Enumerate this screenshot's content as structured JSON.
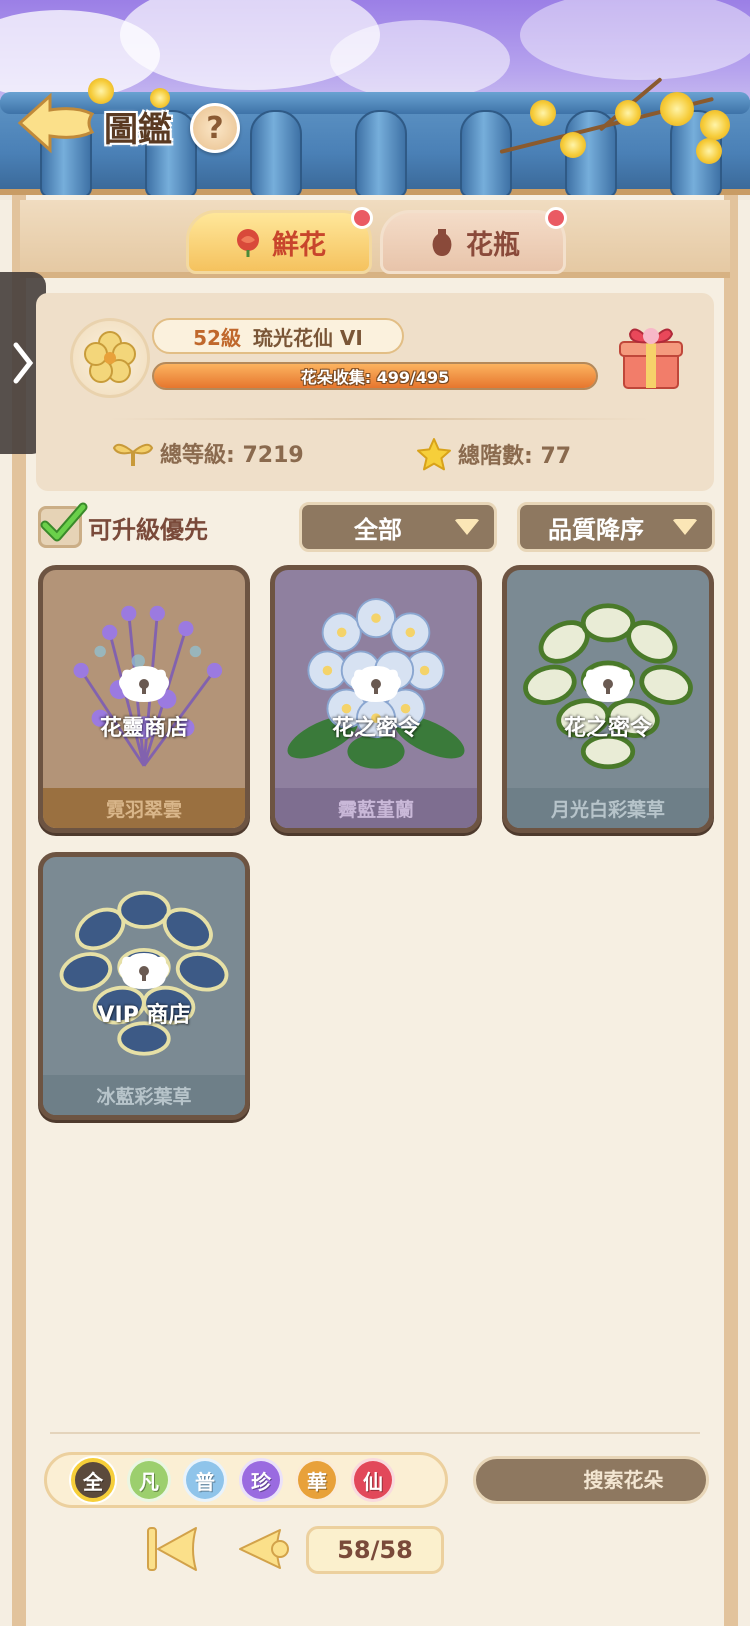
{
  "header": {
    "title": "圖鑑",
    "help_label": "?"
  },
  "tabs": [
    {
      "label": "鮮花",
      "active": true,
      "has_dot": true
    },
    {
      "label": "花瓶",
      "active": false,
      "has_dot": true
    }
  ],
  "player": {
    "level": "52級",
    "rank": "琉光花仙 VI",
    "collection_text": "花朵收集: 499/495",
    "collection_progress": 1.0,
    "total_level_label": "總等級: 7219",
    "total_stage_label": "總階數: 77"
  },
  "filters": {
    "upgrade_priority_label": "可升級優先",
    "upgrade_priority_checked": true,
    "category_label": "全部",
    "sort_label": "品質降序"
  },
  "flowers": [
    {
      "name": "霓羽翠雲",
      "source": "花靈商店",
      "theme": "brown"
    },
    {
      "name": "霽藍堇蘭",
      "source": "花之密令",
      "theme": "purple"
    },
    {
      "name": "月光白彩葉草",
      "source": "花之密令",
      "theme": "slate"
    },
    {
      "name": "冰藍彩葉草",
      "source": "VIP 商店",
      "theme": "slate"
    }
  ],
  "rarity_filters": [
    {
      "label": "全",
      "color": "#5b4a3c",
      "selected": true
    },
    {
      "label": "凡",
      "color": "#9ccf6e",
      "selected": false
    },
    {
      "label": "普",
      "color": "#8fc4ea",
      "selected": false
    },
    {
      "label": "珍",
      "color": "#9a6be0",
      "selected": false
    },
    {
      "label": "華",
      "color": "#e8a13a",
      "selected": false
    },
    {
      "label": "仙",
      "color": "#e2485a",
      "selected": false
    }
  ],
  "search": {
    "placeholder": "搜索花朵"
  },
  "pagination": {
    "text": "58/58"
  },
  "icons": {
    "back": "back-arrow-icon",
    "help": "question-icon",
    "rose": "rose-icon",
    "vase": "vase-icon",
    "emblem": "flower-emblem-icon",
    "gift": "gift-box-icon",
    "sprout": "sprout-icon",
    "star": "star-icon",
    "check": "checkmark-icon",
    "lock": "lock-icon",
    "search": "magnifier-icon",
    "first": "first-page-icon",
    "prev": "previous-page-icon",
    "side": "chevron-right-icon"
  }
}
